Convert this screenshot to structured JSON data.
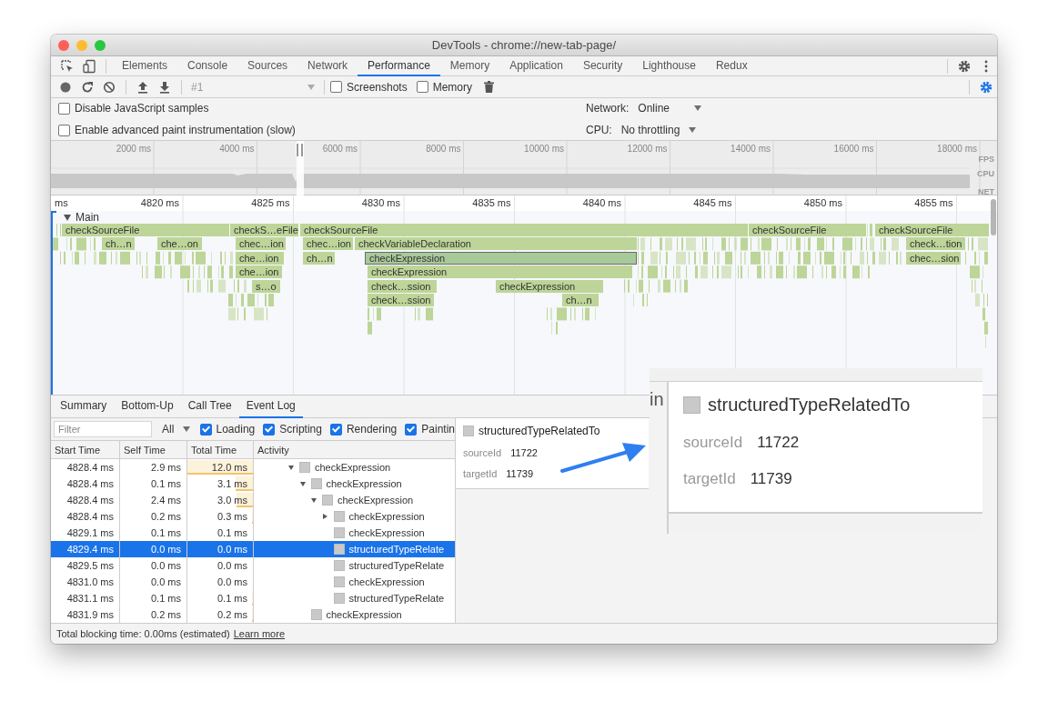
{
  "window": {
    "title": "DevTools - chrome://new-tab-page/"
  },
  "panel_tabs": [
    {
      "label": "Elements",
      "selected": false
    },
    {
      "label": "Console",
      "selected": false
    },
    {
      "label": "Sources",
      "selected": false
    },
    {
      "label": "Network",
      "selected": false
    },
    {
      "label": "Performance",
      "selected": true
    },
    {
      "label": "Memory",
      "selected": false
    },
    {
      "label": "Application",
      "selected": false
    },
    {
      "label": "Security",
      "selected": false
    },
    {
      "label": "Lighthouse",
      "selected": false
    },
    {
      "label": "Redux",
      "selected": false
    }
  ],
  "toolbar": {
    "recording_select": "#1",
    "checkboxes": [
      {
        "label": "Screenshots",
        "checked": false
      },
      {
        "label": "Memory",
        "checked": false
      }
    ]
  },
  "settings": {
    "checkboxes": [
      {
        "label": "Disable JavaScript samples",
        "checked": false
      },
      {
        "label": "Enable advanced paint instrumentation (slow)",
        "checked": false
      }
    ],
    "dropdowns": [
      {
        "label": "Network:",
        "value": "Online"
      },
      {
        "label": "CPU:",
        "value": "No throttling"
      }
    ]
  },
  "overview": {
    "ticks": [
      "2000 ms",
      "4000 ms",
      "6000 ms",
      "8000 ms",
      "10000 ms",
      "12000 ms",
      "14000 ms",
      "16000 ms",
      "18000 ms"
    ],
    "tracks": [
      "FPS",
      "CPU",
      "NET"
    ]
  },
  "flame_chart": {
    "unit_label": "ms",
    "ticks": [
      "4820 ms",
      "4825 ms",
      "4830 ms",
      "4835 ms",
      "4840 ms",
      "4845 ms",
      "4850 ms",
      "4855 ms"
    ],
    "thread": {
      "label": "Main",
      "expanded": true
    },
    "rows": [
      {
        "bars": [
          {
            "label": "checkSourceFile",
            "selected": false
          },
          {
            "label": "checkS…eFile",
            "selected": false
          },
          {
            "label": "checkSourceFile",
            "selected": false
          },
          {
            "label": "checkSourceFile",
            "selected": false
          },
          {
            "label": "checkSourceFile",
            "selected": false
          }
        ]
      },
      {
        "bars": [
          {
            "label": "ch…n",
            "selected": false
          },
          {
            "label": "che…on",
            "selected": false
          },
          {
            "label": "chec…ion",
            "selected": false
          },
          {
            "label": "chec…ion",
            "selected": false
          },
          {
            "label": "checkVariableDeclaration",
            "selected": false
          },
          {
            "label": "check…tion",
            "selected": false
          }
        ]
      },
      {
        "bars": [
          {
            "label": "che…ion",
            "selected": false
          },
          {
            "label": "ch…n",
            "selected": false
          },
          {
            "label": "checkExpression",
            "selected": true
          },
          {
            "label": "chec…sion",
            "selected": false
          }
        ]
      },
      {
        "bars": [
          {
            "label": "che…ion",
            "selected": false
          },
          {
            "label": "checkExpression",
            "selected": false
          }
        ]
      },
      {
        "bars": [
          {
            "label": "s…o",
            "selected": false
          },
          {
            "label": "check…ssion",
            "selected": false
          },
          {
            "label": "checkExpression",
            "selected": false
          }
        ]
      },
      {
        "bars": [
          {
            "label": "check…ssion",
            "selected": false
          },
          {
            "label": "ch…n",
            "selected": false
          }
        ]
      }
    ]
  },
  "bottom_tabs": [
    {
      "label": "Summary",
      "selected": false
    },
    {
      "label": "Bottom-Up",
      "selected": false
    },
    {
      "label": "Call Tree",
      "selected": false
    },
    {
      "label": "Event Log",
      "selected": true
    }
  ],
  "filter": {
    "placeholder": "Filter",
    "level_select": "All",
    "categories": [
      {
        "label": "Loading",
        "checked": true
      },
      {
        "label": "Scripting",
        "checked": true
      },
      {
        "label": "Rendering",
        "checked": true
      },
      {
        "label": "Paintin",
        "checked": true
      }
    ]
  },
  "event_log": {
    "columns": [
      "Start Time",
      "Self Time",
      "Total Time",
      "Activity"
    ],
    "rows": [
      {
        "start": "4828.4 ms",
        "self": "2.9 ms",
        "total": "12.0 ms",
        "level": 1,
        "activity": "checkExpression",
        "expanded": true,
        "selected": false,
        "children": [
          {
            "start": "4828.4 ms",
            "self": "0.1 ms",
            "total": "3.1 ms",
            "level": 0.26,
            "activity": "checkExpression",
            "expanded": true,
            "selected": false,
            "children": [
              {
                "start": "4828.4 ms",
                "self": "2.4 ms",
                "total": "3.0 ms",
                "level": 0.25,
                "activity": "checkExpression",
                "expanded": true,
                "selected": false,
                "children": [
                  {
                    "start": "4828.4 ms",
                    "self": "0.2 ms",
                    "total": "0.3 ms",
                    "level": 0.02,
                    "activity": "checkExpression",
                    "expanded": false,
                    "selected": false
                  },
                  {
                    "start": "4829.1 ms",
                    "self": "0.1 ms",
                    "total": "0.1 ms",
                    "activity": "checkExpression",
                    "selected": false
                  },
                  {
                    "start": "4829.4 ms",
                    "self": "0.0 ms",
                    "total": "0.0 ms",
                    "activity": "structuredTypeRelate",
                    "selected": true
                  },
                  {
                    "start": "4829.5 ms",
                    "self": "0.0 ms",
                    "total": "0.0 ms",
                    "activity": "structuredTypeRelate",
                    "selected": false
                  },
                  {
                    "start": "4831.0 ms",
                    "self": "0.0 ms",
                    "total": "0.0 ms",
                    "activity": "checkExpression",
                    "selected": false
                  },
                  {
                    "start": "4831.1 ms",
                    "self": "0.1 ms",
                    "total": "0.1 ms",
                    "level": 0.01,
                    "activity": "structuredTypeRelate",
                    "selected": false
                  }
                ]
              }
            ]
          },
          {
            "start": "4831.9 ms",
            "self": "0.2 ms",
            "total": "0.2 ms",
            "level": 0.015,
            "activity": "checkExpression",
            "selected": false
          }
        ]
      }
    ]
  },
  "details": {
    "title": "structuredTypeRelatedTo",
    "fields": [
      {
        "name": "sourceId",
        "value": "11722"
      },
      {
        "name": "targetId",
        "value": "11739"
      }
    ]
  },
  "inset": {
    "tab_fragment": "in",
    "title": "structuredTypeRelatedTo",
    "fields": [
      {
        "name": "sourceId",
        "value": "11722"
      },
      {
        "name": "targetId",
        "value": "11739"
      }
    ]
  },
  "status_bar": {
    "text": "Total blocking time: 0.00ms (estimated)",
    "link": "Learn more"
  }
}
